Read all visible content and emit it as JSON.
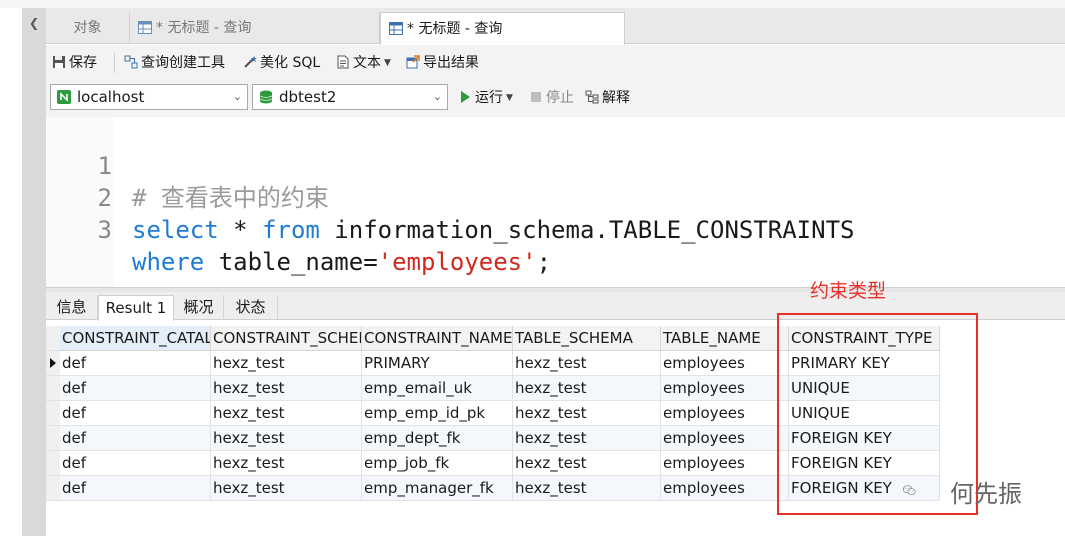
{
  "colors": {
    "accent": "#1e7bd6",
    "string": "#d2281e",
    "annotation": "#e8302a"
  },
  "tabs": [
    {
      "label": "对象",
      "icon": ""
    },
    {
      "label": "* 无标题 - 查询",
      "icon": "table-grid-icon"
    },
    {
      "label": "* 无标题 - 查询",
      "icon": "table-grid-icon",
      "active": true
    }
  ],
  "toolbar": {
    "save": "保存",
    "query_builder": "查询创建工具",
    "beautify": "美化 SQL",
    "text": "文本",
    "export": "导出结果"
  },
  "connection": {
    "value": "localhost"
  },
  "database": {
    "value": "dbtest2"
  },
  "run": {
    "run": "运行",
    "stop": "停止",
    "explain": "解释"
  },
  "editor": {
    "lines": [
      {
        "num": "1",
        "comment": "# 查看表中的约束"
      },
      {
        "num": "2",
        "kw1": "select",
        "t1": " * ",
        "kw2": "from",
        "t2": " information_schema.TABLE_CONSTRAINTS"
      },
      {
        "num": "3",
        "kw1": "where",
        "t1": " table_name=",
        "str": "'employees'",
        "t2": ";"
      }
    ]
  },
  "result_tabs": [
    {
      "label": "信息"
    },
    {
      "label": "Result 1",
      "active": true
    },
    {
      "label": "概况"
    },
    {
      "label": "状态"
    }
  ],
  "grid": {
    "columns": [
      "CONSTRAINT_CATALOG",
      "CONSTRAINT_SCHEMA",
      "CONSTRAINT_NAME",
      "TABLE_SCHEMA",
      "TABLE_NAME",
      "CONSTRAINT_TYPE"
    ],
    "rows": [
      [
        "def",
        "hexz_test",
        "PRIMARY",
        "hexz_test",
        "employees",
        "PRIMARY KEY"
      ],
      [
        "def",
        "hexz_test",
        "emp_email_uk",
        "hexz_test",
        "employees",
        "UNIQUE"
      ],
      [
        "def",
        "hexz_test",
        "emp_emp_id_pk",
        "hexz_test",
        "employees",
        "UNIQUE"
      ],
      [
        "def",
        "hexz_test",
        "emp_dept_fk",
        "hexz_test",
        "employees",
        "FOREIGN KEY"
      ],
      [
        "def",
        "hexz_test",
        "emp_job_fk",
        "hexz_test",
        "employees",
        "FOREIGN KEY"
      ],
      [
        "def",
        "hexz_test",
        "emp_manager_fk",
        "hexz_test",
        "employees",
        "FOREIGN KEY"
      ]
    ]
  },
  "annotation": {
    "label": "约束类型"
  },
  "watermark": {
    "text": "何先振"
  }
}
